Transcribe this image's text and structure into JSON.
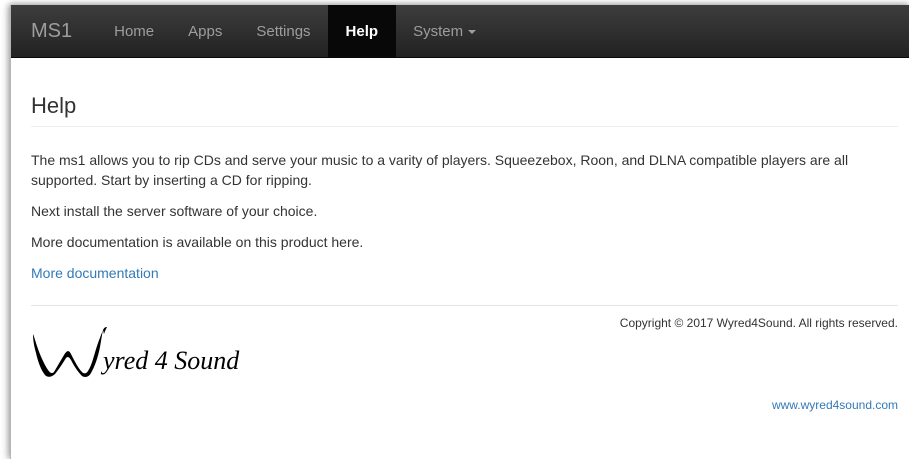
{
  "navbar": {
    "brand": "MS1",
    "items": [
      {
        "label": "Home"
      },
      {
        "label": "Apps"
      },
      {
        "label": "Settings"
      },
      {
        "label": "Help"
      },
      {
        "label": "System"
      }
    ],
    "active": "Help",
    "bg_color": "#222222",
    "active_bg_color": "#080808"
  },
  "page": {
    "title": "Help",
    "paragraphs": [
      "The ms1 allows you to rip CDs and serve your music to a varity of players. Squeezebox, Roon, and DLNA compatible players are all supported. Start by inserting a CD for ripping.",
      "Next install the server software of your choice.",
      "More documentation is available on this product here."
    ],
    "doc_link": "More documentation",
    "link_color": "#337ab7"
  },
  "footer": {
    "copyright": "Copyright © 2017 Wyred4Sound. All rights reserved.",
    "logo_text": "yred 4 Sound",
    "site_link": "www.wyred4sound.com"
  }
}
